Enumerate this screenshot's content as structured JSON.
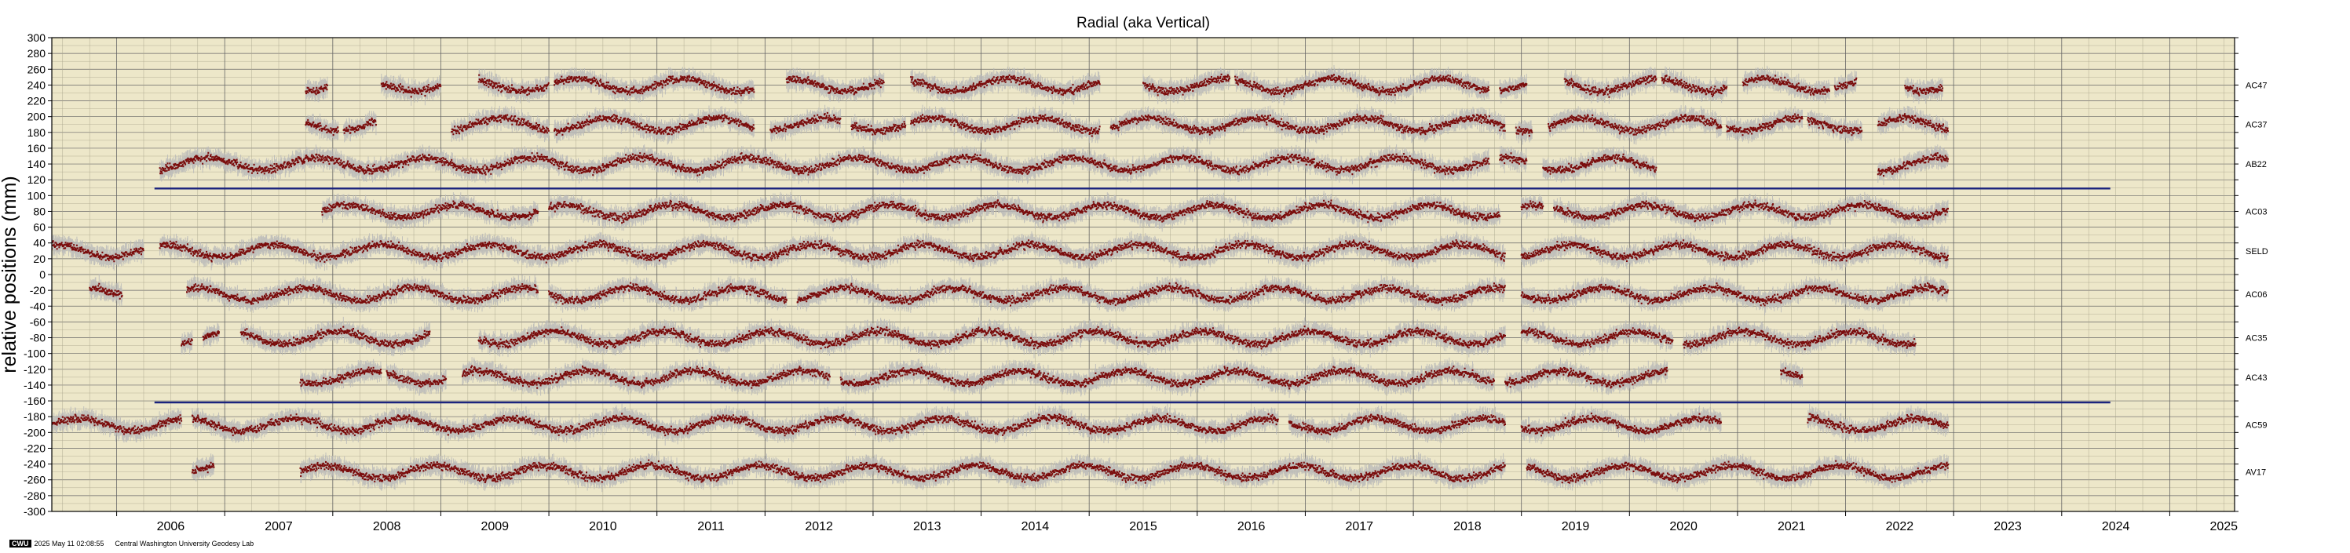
{
  "chart_data": {
    "type": "scatter",
    "title": "Radial (aka Vertical)",
    "ylabel": "relative positions (mm)",
    "xlabel": "",
    "xlim": [
      2005.4,
      2025.6
    ],
    "ylim": [
      -300,
      300
    ],
    "y_ticks": [
      300,
      280,
      260,
      240,
      220,
      200,
      180,
      160,
      140,
      120,
      100,
      80,
      60,
      40,
      20,
      0,
      -20,
      -40,
      -60,
      -80,
      -100,
      -120,
      -140,
      -160,
      -180,
      -200,
      -220,
      -240,
      -260,
      -280,
      -300
    ],
    "x_tick_labels": [
      "2006",
      "2007",
      "2008",
      "2009",
      "2010",
      "2011",
      "2012",
      "2013",
      "2014",
      "2015",
      "2016",
      "2017",
      "2018",
      "2019",
      "2020",
      "2021",
      "2022",
      "2023",
      "2024",
      "2025"
    ],
    "grid": true,
    "series": [
      {
        "name": "AC47",
        "offset": 240,
        "segments": [
          [
            2007.75,
            2007.95
          ],
          [
            2008.45,
            2009.0
          ],
          [
            2009.35,
            2010.0
          ],
          [
            2010.05,
            2011.9
          ],
          [
            2012.2,
            2013.1
          ],
          [
            2013.35,
            2015.1
          ],
          [
            2015.5,
            2016.3
          ],
          [
            2016.35,
            2018.7
          ],
          [
            2018.8,
            2019.05
          ],
          [
            2019.4,
            2020.25
          ],
          [
            2020.3,
            2020.9
          ],
          [
            2021.05,
            2021.85
          ],
          [
            2021.9,
            2022.1
          ],
          [
            2022.55,
            2022.9
          ]
        ]
      },
      {
        "name": "AC37",
        "offset": 190,
        "segments": [
          [
            2007.75,
            2008.05
          ],
          [
            2008.1,
            2008.4
          ],
          [
            2009.1,
            2010.0
          ],
          [
            2010.05,
            2011.9
          ],
          [
            2012.05,
            2012.7
          ],
          [
            2012.8,
            2013.3
          ],
          [
            2013.35,
            2015.1
          ],
          [
            2015.2,
            2018.85
          ],
          [
            2018.95,
            2019.1
          ],
          [
            2019.25,
            2020.85
          ],
          [
            2020.9,
            2021.6
          ],
          [
            2021.65,
            2022.15
          ],
          [
            2022.3,
            2022.95
          ]
        ]
      },
      {
        "name": "AB22",
        "offset": 140,
        "segments": [
          [
            2006.4,
            2018.7
          ],
          [
            2018.8,
            2019.05
          ],
          [
            2019.2,
            2020.25
          ],
          [
            2022.3,
            2022.95
          ]
        ]
      },
      {
        "name": "AC03",
        "offset": 80,
        "segments": [
          [
            2007.9,
            2009.9
          ],
          [
            2010.0,
            2018.8
          ],
          [
            2019.0,
            2019.2
          ],
          [
            2019.3,
            2022.95
          ]
        ]
      },
      {
        "name": "SELD",
        "offset": 30,
        "segments": [
          [
            2005.4,
            2006.25
          ],
          [
            2006.4,
            2018.85
          ],
          [
            2019.0,
            2022.95
          ]
        ]
      },
      {
        "name": "AC06",
        "offset": -25,
        "segments": [
          [
            2005.75,
            2006.05
          ],
          [
            2006.65,
            2009.9
          ],
          [
            2010.0,
            2012.2
          ],
          [
            2012.3,
            2018.85
          ],
          [
            2019.0,
            2022.95
          ]
        ]
      },
      {
        "name": "AC35",
        "offset": -80,
        "segments": [
          [
            2006.6,
            2006.7
          ],
          [
            2006.8,
            2006.95
          ],
          [
            2007.15,
            2008.9
          ],
          [
            2009.35,
            2018.85
          ],
          [
            2019.0,
            2020.4
          ],
          [
            2020.5,
            2022.65
          ]
        ]
      },
      {
        "name": "AC43",
        "offset": -130,
        "segments": [
          [
            2007.7,
            2008.45
          ],
          [
            2008.5,
            2009.05
          ],
          [
            2009.2,
            2012.6
          ],
          [
            2012.7,
            2018.75
          ],
          [
            2018.85,
            2020.35
          ],
          [
            2021.4,
            2021.6
          ]
        ]
      },
      {
        "name": "AC59",
        "offset": -190,
        "segments": [
          [
            2005.4,
            2006.6
          ],
          [
            2006.7,
            2016.75
          ],
          [
            2016.85,
            2018.85
          ],
          [
            2019.0,
            2020.85
          ],
          [
            2021.65,
            2022.95
          ]
        ]
      },
      {
        "name": "AV17",
        "offset": -250,
        "segments": [
          [
            2006.7,
            2006.9
          ],
          [
            2007.7,
            2018.85
          ],
          [
            2019.05,
            2022.95
          ]
        ]
      }
    ],
    "reference_lines": [
      {
        "y": 109,
        "x_range": [
          2006.35,
          2024.45
        ],
        "color": "#1a237e"
      },
      {
        "y": -162,
        "x_range": [
          2006.35,
          2024.45
        ],
        "color": "#1a237e"
      }
    ],
    "colors": {
      "plot_bg": "#ede7c9",
      "marker": "#7a0b0b",
      "error_bar": "#b8b8b8",
      "grid_major": "#666666",
      "grid_minor": "#a9a58c"
    }
  },
  "footer": {
    "logo": "CWU",
    "timestamp": "2025 May 11 02:08:55",
    "credit": "Central Washington University Geodesy Lab"
  }
}
